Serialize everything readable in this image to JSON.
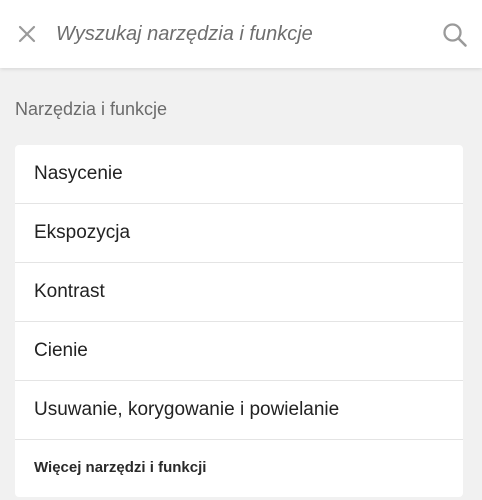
{
  "search": {
    "value": "",
    "placeholder": "Wyszukaj narzędzia i funkcje"
  },
  "section": {
    "title": "Narzędzia i funkcje"
  },
  "items": [
    {
      "label": "Nasycenie"
    },
    {
      "label": "Ekspozycja"
    },
    {
      "label": "Kontrast"
    },
    {
      "label": "Cienie"
    },
    {
      "label": "Usuwanie, korygowanie i powielanie"
    }
  ],
  "more": {
    "label": "Więcej narzędzi i funkcji"
  },
  "icons": {
    "close": "close-icon",
    "search": "search-icon"
  },
  "colors": {
    "background": "#f1f1f1",
    "card": "#ffffff",
    "icon": "#9a9a9a",
    "text": "#222222",
    "muted": "#6b6b6b"
  }
}
